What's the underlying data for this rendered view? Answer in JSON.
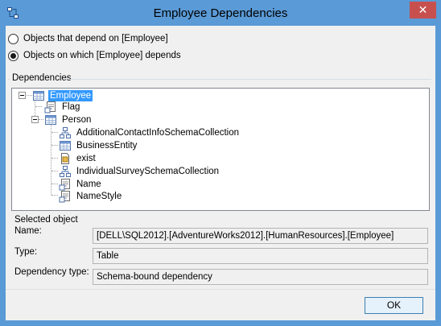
{
  "window": {
    "title": "Employee Dependencies",
    "close_glyph": "✕"
  },
  "options": [
    {
      "label": "Objects that depend on [Employee]",
      "checked": false
    },
    {
      "label": "Objects on which [Employee] depends",
      "checked": true
    }
  ],
  "dependencies": {
    "group_label": "Dependencies",
    "tree": [
      {
        "label": "Employee",
        "icon": "table-icon",
        "selected": true
      },
      {
        "label": "Flag",
        "icon": "user-defined-type-icon"
      },
      {
        "label": "Person",
        "icon": "table-icon"
      },
      {
        "label": "AdditionalContactInfoSchemaCollection",
        "icon": "xml-schema-collection-icon"
      },
      {
        "label": "BusinessEntity",
        "icon": "table-icon"
      },
      {
        "label": "exist",
        "icon": "function-icon"
      },
      {
        "label": "IndividualSurveySchemaCollection",
        "icon": "xml-schema-collection-icon"
      },
      {
        "label": "Name",
        "icon": "user-defined-type-icon"
      },
      {
        "label": "NameStyle",
        "icon": "user-defined-type-icon"
      }
    ]
  },
  "selected_object": {
    "heading": "Selected object",
    "name_label": "Name:",
    "name_value": "[DELL\\SQL2012].[AdventureWorks2012].[HumanResources].[Employee]",
    "type_label": "Type:",
    "type_value": "Table",
    "dependency_label": "Dependency type:",
    "dependency_value": "Schema-bound dependency"
  },
  "footer": {
    "ok_label": "OK"
  },
  "colors": {
    "titlebar": "#5a9ad6",
    "close": "#c7504f",
    "selection": "#3399ff"
  }
}
